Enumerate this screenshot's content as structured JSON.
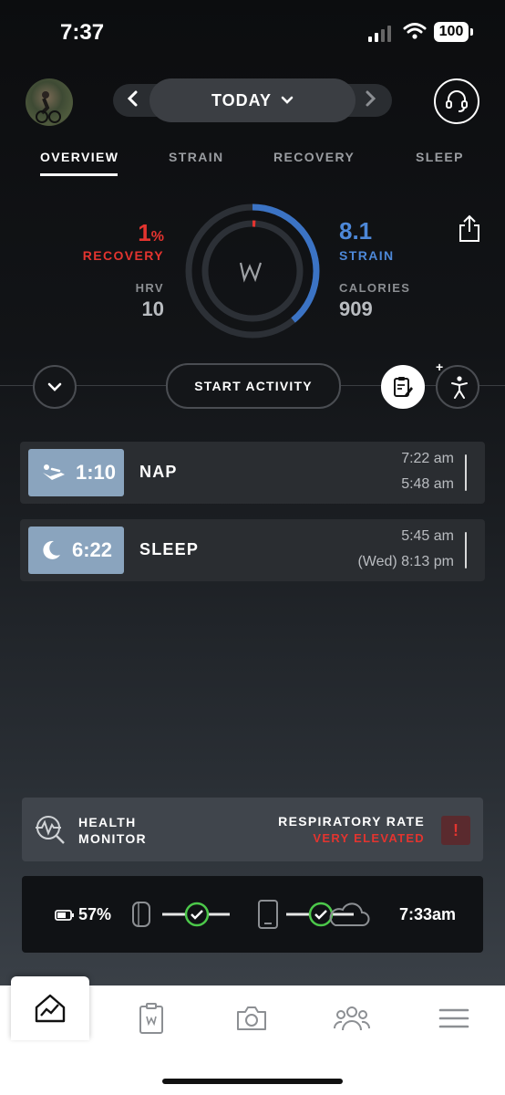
{
  "status_bar": {
    "time": "7:37",
    "battery": "100"
  },
  "header": {
    "date_label": "TODAY"
  },
  "tabs": [
    {
      "label": "OVERVIEW"
    },
    {
      "label": "STRAIN"
    },
    {
      "label": "RECOVERY"
    },
    {
      "label": "SLEEP"
    }
  ],
  "overview": {
    "recovery_value": "1",
    "recovery_unit": "%",
    "recovery_label": "RECOVERY",
    "hrv_label": "HRV",
    "hrv_value": "10",
    "strain_value": "8.1",
    "strain_label": "STRAIN",
    "calories_label": "CALORIES",
    "calories_value": "909",
    "strain_fraction": 0.39,
    "colors": {
      "recovery": "#e3342f",
      "strain": "#3b73c4"
    }
  },
  "actions": {
    "start_activity": "START ACTIVITY"
  },
  "activities": [
    {
      "icon": "recliner-icon",
      "duration": "1:10",
      "name": "NAP",
      "start": "7:22 am",
      "end": "5:48 am"
    },
    {
      "icon": "moon-icon",
      "duration": "6:22",
      "name": "SLEEP",
      "start": "5:45 am",
      "end": "(Wed) 8:13 pm"
    }
  ],
  "health_monitor": {
    "title_line1": "HEALTH",
    "title_line2": "MONITOR",
    "metric": "RESPIRATORY RATE",
    "status": "VERY ELEVATED",
    "alert": "!"
  },
  "sync": {
    "battery": "57%",
    "last_sync": "7:33am"
  },
  "bottom_nav": [
    "home-icon",
    "journal-icon",
    "camera-icon",
    "community-icon",
    "menu-icon"
  ]
}
